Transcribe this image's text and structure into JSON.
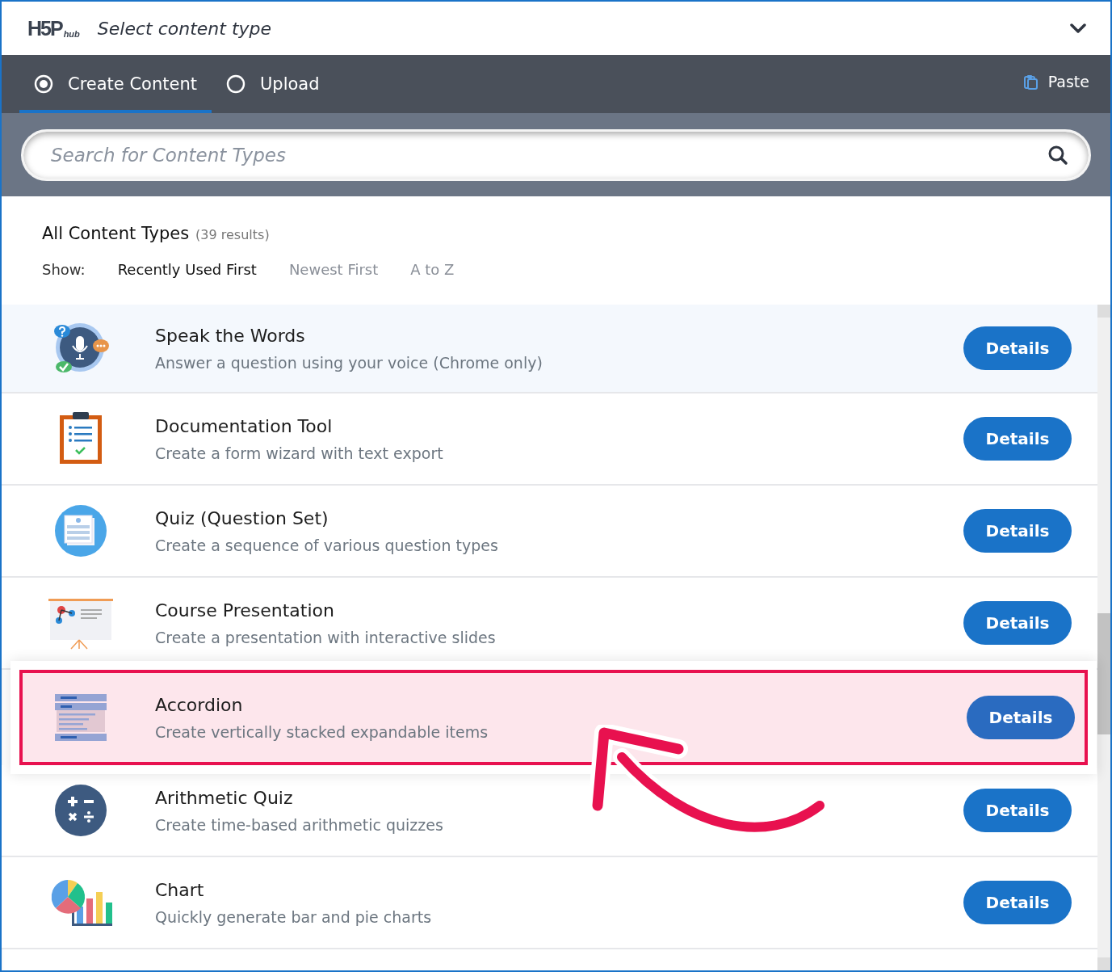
{
  "header": {
    "logo_text": "H5P",
    "logo_sub": "hub",
    "title": "Select content type"
  },
  "tabs": [
    {
      "label": "Create Content",
      "selected": true
    },
    {
      "label": "Upload",
      "selected": false
    }
  ],
  "paste": {
    "label": "Paste"
  },
  "search": {
    "placeholder": "Search for Content Types"
  },
  "listing": {
    "title": "All Content Types",
    "count": "(39 results)",
    "show_label": "Show:",
    "sort_options": [
      {
        "label": "Recently Used First",
        "selected": true
      },
      {
        "label": "Newest First",
        "selected": false
      },
      {
        "label": "A to Z",
        "selected": false
      }
    ]
  },
  "items": [
    {
      "kind": "speech",
      "title": "Speak the Words",
      "description": "Answer a question using your voice (Chrome only)",
      "button": "Details",
      "selected": true,
      "highlighted": false
    },
    {
      "kind": "clipboard",
      "title": "Documentation Tool",
      "description": "Create a form wizard with text export",
      "button": "Details",
      "selected": false,
      "highlighted": false
    },
    {
      "kind": "quiz",
      "title": "Quiz (Question Set)",
      "description": "Create a sequence of various question types",
      "button": "Details",
      "selected": false,
      "highlighted": false
    },
    {
      "kind": "presentation",
      "title": "Course Presentation",
      "description": "Create a presentation with interactive slides",
      "button": "Details",
      "selected": false,
      "highlighted": false
    },
    {
      "kind": "accordion",
      "title": "Accordion",
      "description": "Create vertically stacked expandable items",
      "button": "Details",
      "selected": false,
      "highlighted": true
    },
    {
      "kind": "arithmetic",
      "title": "Arithmetic Quiz",
      "description": "Create time-based arithmetic quizzes",
      "button": "Details",
      "selected": false,
      "highlighted": false
    },
    {
      "kind": "chart",
      "title": "Chart",
      "description": "Quickly generate bar and pie charts",
      "button": "Details",
      "selected": false,
      "highlighted": false
    }
  ]
}
